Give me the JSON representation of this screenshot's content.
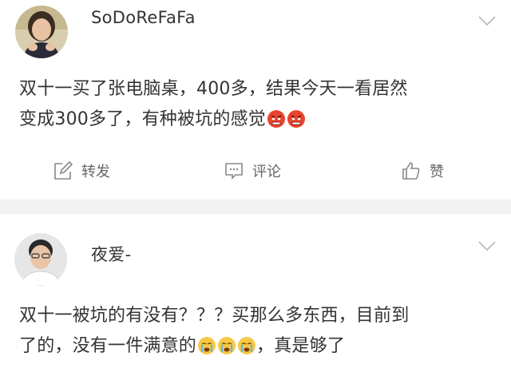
{
  "posts": [
    {
      "username": "SoDoReFaFa",
      "content_line1": "双十一买了张电脑桌，400多，结果今天一看居然",
      "content_line2": "变成300多了，有种被坑的感觉",
      "emoji": "angry-face-icon",
      "actions": {
        "repost_label": "转发",
        "comment_label": "评论",
        "like_label": "赞"
      }
    },
    {
      "username": "夜爱-",
      "content_line1": "双十一被坑的有没有？？？买那么多东西，目前到",
      "content_line2a": "了的，没有一件满意的",
      "content_line2b": "，真是够了",
      "emoji": "crying-face-icon"
    }
  ],
  "colors": {
    "separator": "#f1f1f1",
    "text": "#333333",
    "muted": "#666666"
  }
}
